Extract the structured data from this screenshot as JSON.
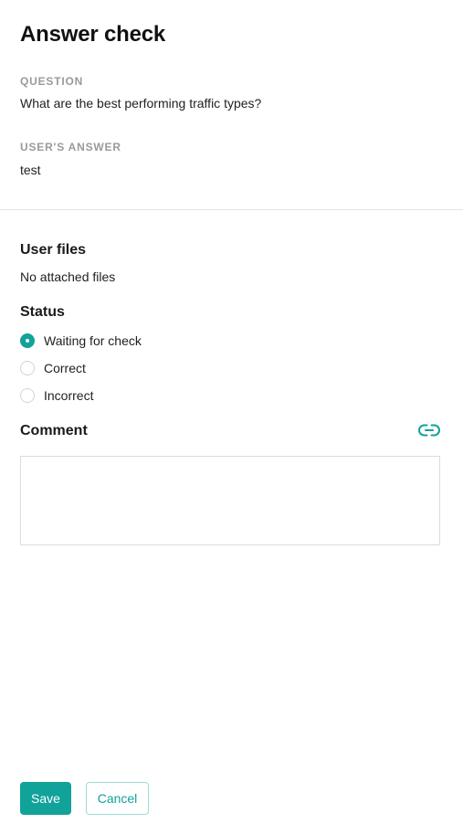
{
  "header": {
    "title": "Answer check"
  },
  "question": {
    "caption": "QUESTION",
    "text": "What are the best performing traffic types?"
  },
  "answer": {
    "caption": "USER'S ANSWER",
    "text": "test"
  },
  "files": {
    "title": "User files",
    "empty_text": "No attached files"
  },
  "status": {
    "title": "Status",
    "selected": "Waiting for check",
    "options": [
      {
        "label": "Waiting for check",
        "checked": true
      },
      {
        "label": "Correct",
        "checked": false
      },
      {
        "label": "Incorrect",
        "checked": false
      }
    ]
  },
  "comment": {
    "title": "Comment",
    "value": "",
    "link_icon": "link-icon"
  },
  "actions": {
    "save_label": "Save",
    "cancel_label": "Cancel"
  },
  "colors": {
    "accent": "#11a29a",
    "caption": "#9a9a9a",
    "divider": "#e4e4e4"
  }
}
